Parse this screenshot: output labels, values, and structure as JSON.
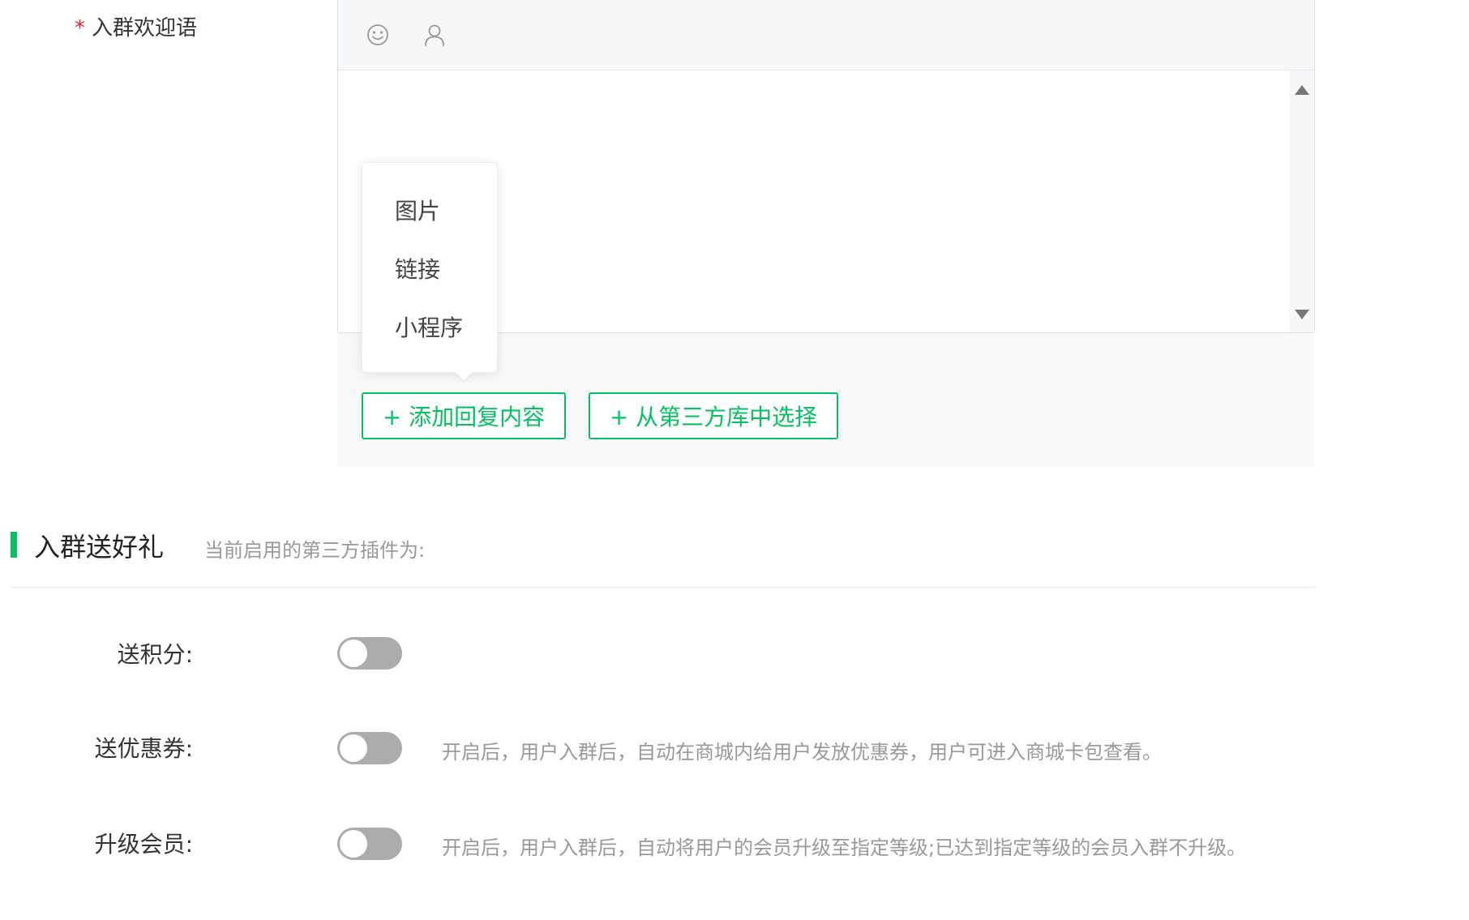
{
  "welcome": {
    "required_mark": "*",
    "label": "入群欢迎语",
    "toolbar": {
      "emoji_icon": "emoji-icon",
      "mention_icon": "user-icon"
    },
    "content": "",
    "insert_menu": {
      "items": [
        "图片",
        "链接",
        "小程序"
      ]
    },
    "add_reply_label": "+ 添加回复内容",
    "third_party_label": "+ 从第三方库中选择"
  },
  "gift_section": {
    "title": "入群送好礼",
    "note": "当前启用的第三方插件为:",
    "rows": [
      {
        "label": "送积分:",
        "enabled": false,
        "hint": ""
      },
      {
        "label": "送优惠券:",
        "enabled": false,
        "hint": "开启后，用户入群后，自动在商城内给用户发放优惠券，用户可进入商城卡包查看。"
      },
      {
        "label": "升级会员:",
        "enabled": false,
        "hint": "开启后，用户入群后，自动将用户的会员升级至指定等级;已达到指定等级的会员入群不升级。"
      }
    ]
  },
  "colors": {
    "accent": "#07c160",
    "required": "#f5222d",
    "toggle_off": "#acacac",
    "hint_text": "#999999"
  }
}
